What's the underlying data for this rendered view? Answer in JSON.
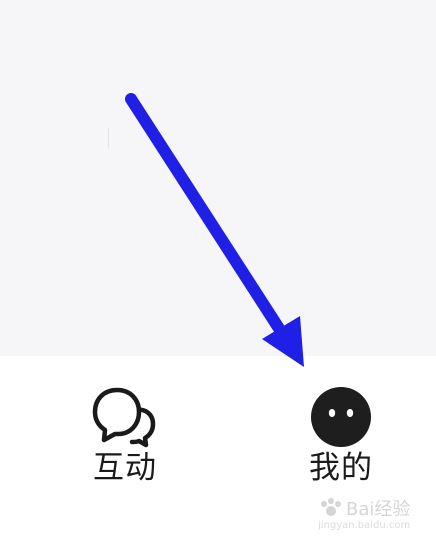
{
  "tab_bar": {
    "tabs": [
      {
        "label": "互动",
        "icon": "chat-bubbles-icon"
      },
      {
        "label": "我的",
        "icon": "profile-face-icon"
      }
    ]
  },
  "annotation": {
    "arrow_color": "#1f1fe6",
    "arrow_icon": "arrow-pointer-icon"
  },
  "watermark": {
    "brand": "Bai经验",
    "domain": "jingyan.baidu.com"
  }
}
